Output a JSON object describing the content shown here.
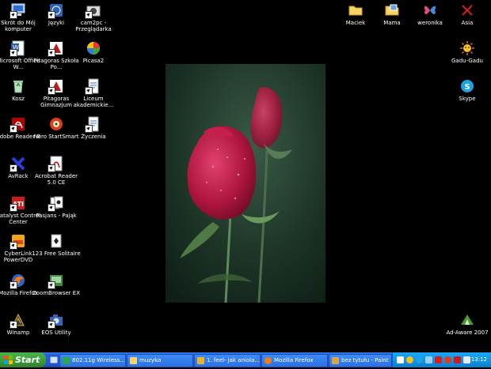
{
  "desktop": {
    "icons": [
      {
        "label": "Skrót do Mój komputer"
      },
      {
        "label": "Microsoft Office W..."
      },
      {
        "label": "Kosz"
      },
      {
        "label": "Adobe Reader 8"
      },
      {
        "label": "AvRack"
      },
      {
        "label": "Catalyst Control Center"
      },
      {
        "label": "CyberLink PowerDVD"
      },
      {
        "label": "Mozilla Firefox"
      },
      {
        "label": "Winamp"
      },
      {
        "label": "Języki"
      },
      {
        "label": "Pitagoras Szkoła Po..."
      },
      {
        "label": "Pitagoras Gimnazjum"
      },
      {
        "label": "Nero StartSmart"
      },
      {
        "label": "Acrobat Reader 5.0 CE"
      },
      {
        "label": "Pasjans - Pająk"
      },
      {
        "label": "123 Free Solitaire"
      },
      {
        "label": "ZoomBrowser EX"
      },
      {
        "label": "EOS Utility"
      },
      {
        "label": "cam2pc - Przeglądarka"
      },
      {
        "label": "Picasa2"
      },
      {
        "label": "Liceum akademickie..."
      },
      {
        "label": "Życzenia"
      },
      {
        "label": "Maciek"
      },
      {
        "label": "Mama"
      },
      {
        "label": "weronika"
      },
      {
        "label": "Asia"
      },
      {
        "label": "Gadu-Gadu"
      },
      {
        "label": "Skype"
      },
      {
        "label": "Ad-Aware 2007"
      }
    ]
  },
  "taskbar": {
    "start_label": "Start",
    "tasks": [
      {
        "label": "802.11g Wireless..."
      },
      {
        "label": "muzyka"
      },
      {
        "label": "1. feel- jak aniola..."
      },
      {
        "label": "Mozilla Firefox"
      },
      {
        "label": "bez tytułu - Paint"
      }
    ],
    "clock": "13:12"
  }
}
